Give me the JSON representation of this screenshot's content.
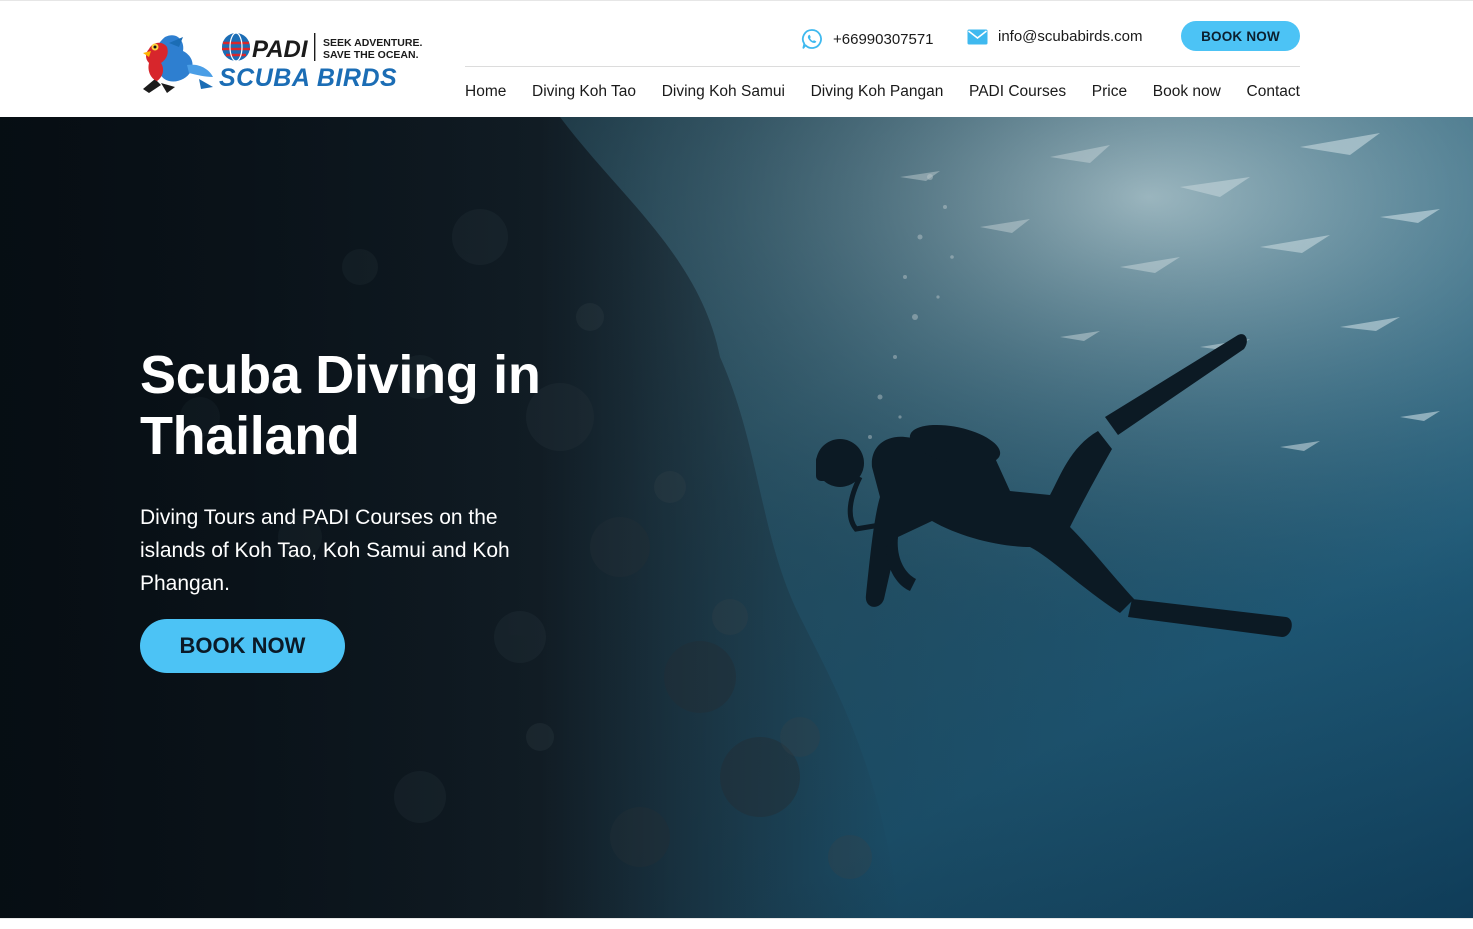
{
  "header": {
    "logo": {
      "brand_top": "PADI",
      "tagline_line1": "SEEK ADVENTURE.",
      "tagline_line2": "SAVE THE OCEAN.",
      "brand_name": "SCUBA BIRDS"
    },
    "phone": "+66990307571",
    "email": "info@scubabirds.com",
    "book_button": "BOOK NOW",
    "nav": [
      "Home",
      "Diving Koh Tao",
      "Diving Koh Samui",
      "Diving Koh Pangan",
      "PADI Courses",
      "Price",
      "Book now",
      "Contact"
    ]
  },
  "hero": {
    "title": "Scuba Diving in Thailand",
    "subtitle": "Diving Tours and PADI Courses on the islands of Koh Tao, Koh Samui and Koh Phangan.",
    "button": "BOOK NOW"
  },
  "colors": {
    "accent": "#4cc3f5",
    "logo_blue": "#1b6db5",
    "logo_red": "#d7262c",
    "hero_dark": "#0d1b26"
  },
  "icons": {
    "phone": "whatsapp-icon",
    "email": "envelope-icon"
  }
}
